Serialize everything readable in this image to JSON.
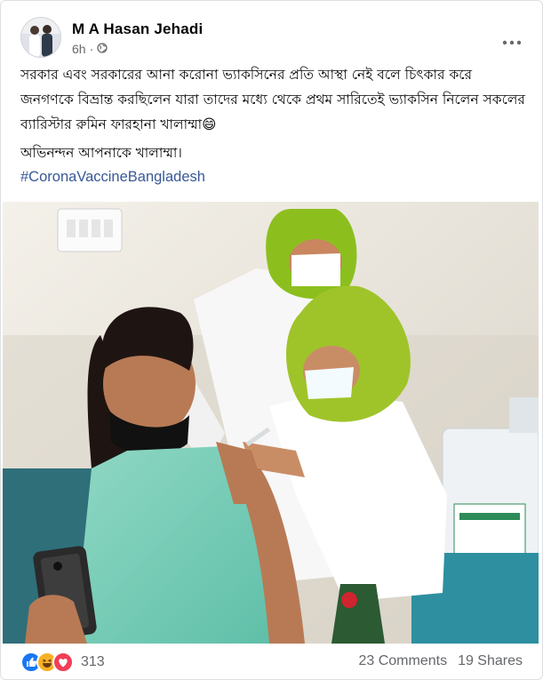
{
  "post": {
    "author": "M A Hasan Jehadi",
    "time": "6h",
    "privacy_icon": "globe-icon",
    "options_icon": "more-horizontal-icon",
    "text_line1": "সরকার এবং সরকারের আনা করোনা ভ্যাকসিনের প্রতি আস্থা নেই বলে চিৎকার করে জনগণকে বিভ্রান্ত করছিলেন যারা তাদের মধ্যে থেকে প্রথম সারিতেই ভ্যাকসিন নিলেন সকলের ব্যারিস্টার রুমিন ফারহানা খালাম্মা😄",
    "text_line2": "অভিনন্দন আপনাকে খালাম্মা।",
    "hashtag": "#CoronaVaccineBangladesh"
  },
  "footer": {
    "reaction_icons": [
      "like-icon",
      "haha-icon",
      "love-icon"
    ],
    "reaction_count": "313",
    "comments": "23 Comments",
    "shares": "19 Shares"
  },
  "colors": {
    "link": "#385898",
    "secondary_text": "#65676b",
    "like": "#1877f2",
    "haha": "#f7b125",
    "love": "#f33e58"
  }
}
